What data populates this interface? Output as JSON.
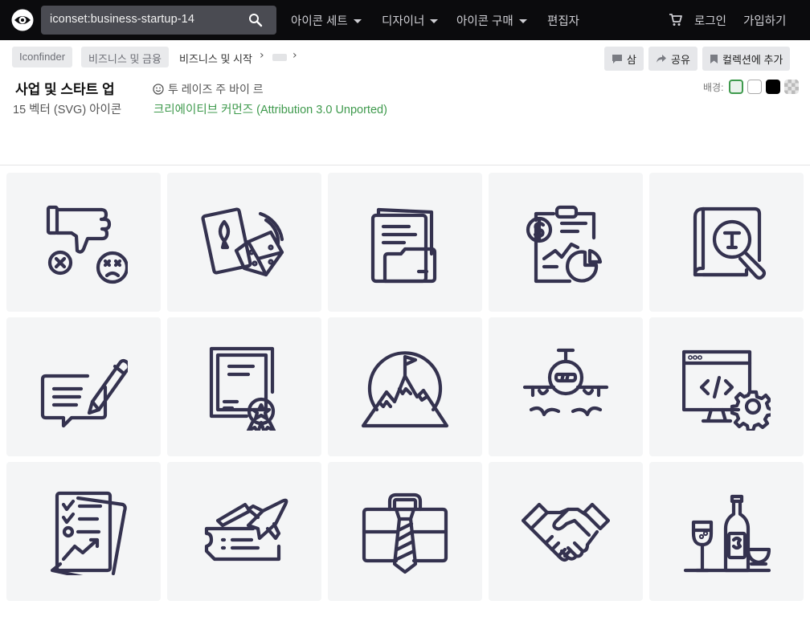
{
  "header": {
    "search_value": "iconset:business-startup-14",
    "nav": [
      "아이콘 세트",
      "디자이너",
      "아이콘 구매",
      "편집자"
    ],
    "login": "로그인",
    "signup": "가입하기"
  },
  "breadcrumb": {
    "items": [
      "Iconfinder",
      "비즈니스 및 금융",
      "비즈니스 및 시작"
    ]
  },
  "actions": {
    "comment": "삼",
    "share": "공유",
    "add_collection": "컬렉션에 추가"
  },
  "iconset": {
    "title": "사업 및 스타트 업",
    "subtitle": "15 벡터 (SVG) 아이콘",
    "author": "투 레이즈 주 바이 르",
    "license": "크리에이티브 커먼즈 (Attribution 3.0 Unported)"
  },
  "background": {
    "label": "배경:",
    "options": [
      "light-gray",
      "white",
      "black",
      "transparent"
    ],
    "selected": "light-gray"
  },
  "icons": [
    "thumbs-down-icon",
    "gamble-dice-icon",
    "folder-documents-icon",
    "financial-report-icon",
    "search-text-icon",
    "signing-document-icon",
    "certificate-icon",
    "mountain-goal-icon",
    "airplane-icon",
    "web-development-icon",
    "checklist-report-icon",
    "flight-ticket-icon",
    "briefcase-tie-icon",
    "handshake-icon",
    "celebration-drinks-icon"
  ],
  "colors": {
    "topbar": "#0b0b0d",
    "icon_stroke": "#34324f",
    "license_green": "#3f9a4d"
  }
}
